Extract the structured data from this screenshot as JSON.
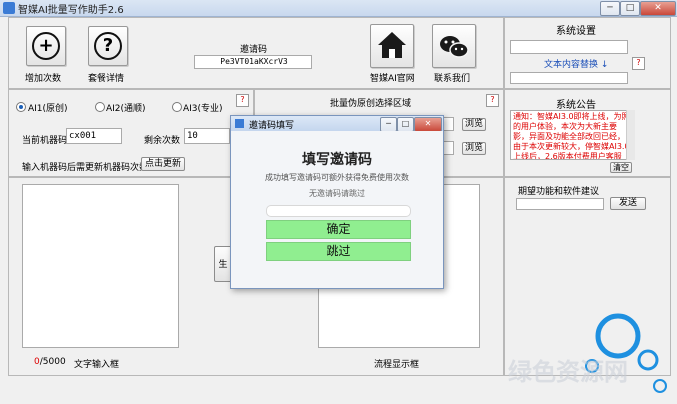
{
  "window": {
    "title": "智媒AI批量写作助手2.6",
    "min": "─",
    "max": "□",
    "close": "✕"
  },
  "toolbar": {
    "add_label": "增加次数",
    "add_glyph": "+",
    "help_label": "套餐详情",
    "help_glyph": "?",
    "invite_label": "邀请码",
    "invite_code": "Pe3VT01aKXcrV3",
    "home_label": "智媒AI官网",
    "contact_label": "联系我们"
  },
  "settings": {
    "title": "系统设置",
    "link": "文本内容替换",
    "link_arrow": "↓",
    "q": "?"
  },
  "modes": {
    "ai1": "AI1(原创)",
    "ai2": "AI2(通顺)",
    "ai3": "AI3(专业)",
    "q": "?"
  },
  "machine": {
    "label": "当前机器码",
    "value": "cx001",
    "remaining_label": "剩余次数",
    "remaining_value": "10",
    "update_prompt": "输入机器码后需更新机器码次数",
    "update_button": "点击更新"
  },
  "batch": {
    "title": "批量伪原创选择区域",
    "q": "?",
    "browse1": "浏览",
    "browse2": "浏览"
  },
  "announce": {
    "title": "系统公告",
    "text": "通知：智媒AI3.0即将上线，为照的用户体验，本次为大新主要影，异面及功能全部改回已经，由于本次更新较大，停智媒AI3.0上线后，2.6版本付费用户客服",
    "clear": "清空"
  },
  "feedback": {
    "title": "期望功能和软件建议",
    "send": "发送"
  },
  "bottom": {
    "counter": "0",
    "counter_total": "/5000",
    "text_input_label": "文字输入框",
    "flow_label": "流程显示框"
  },
  "dialog": {
    "title": "邀请码填写",
    "min": "─",
    "max": "□",
    "close": "✕",
    "heading": "填写邀请码",
    "desc": "成功填写邀请码可额外获得免费使用次数",
    "hint": "无邀请码请跳过",
    "confirm": "确定",
    "skip": "跳过"
  },
  "hidden_btn_text": "生",
  "watermark": "绿色资源网"
}
